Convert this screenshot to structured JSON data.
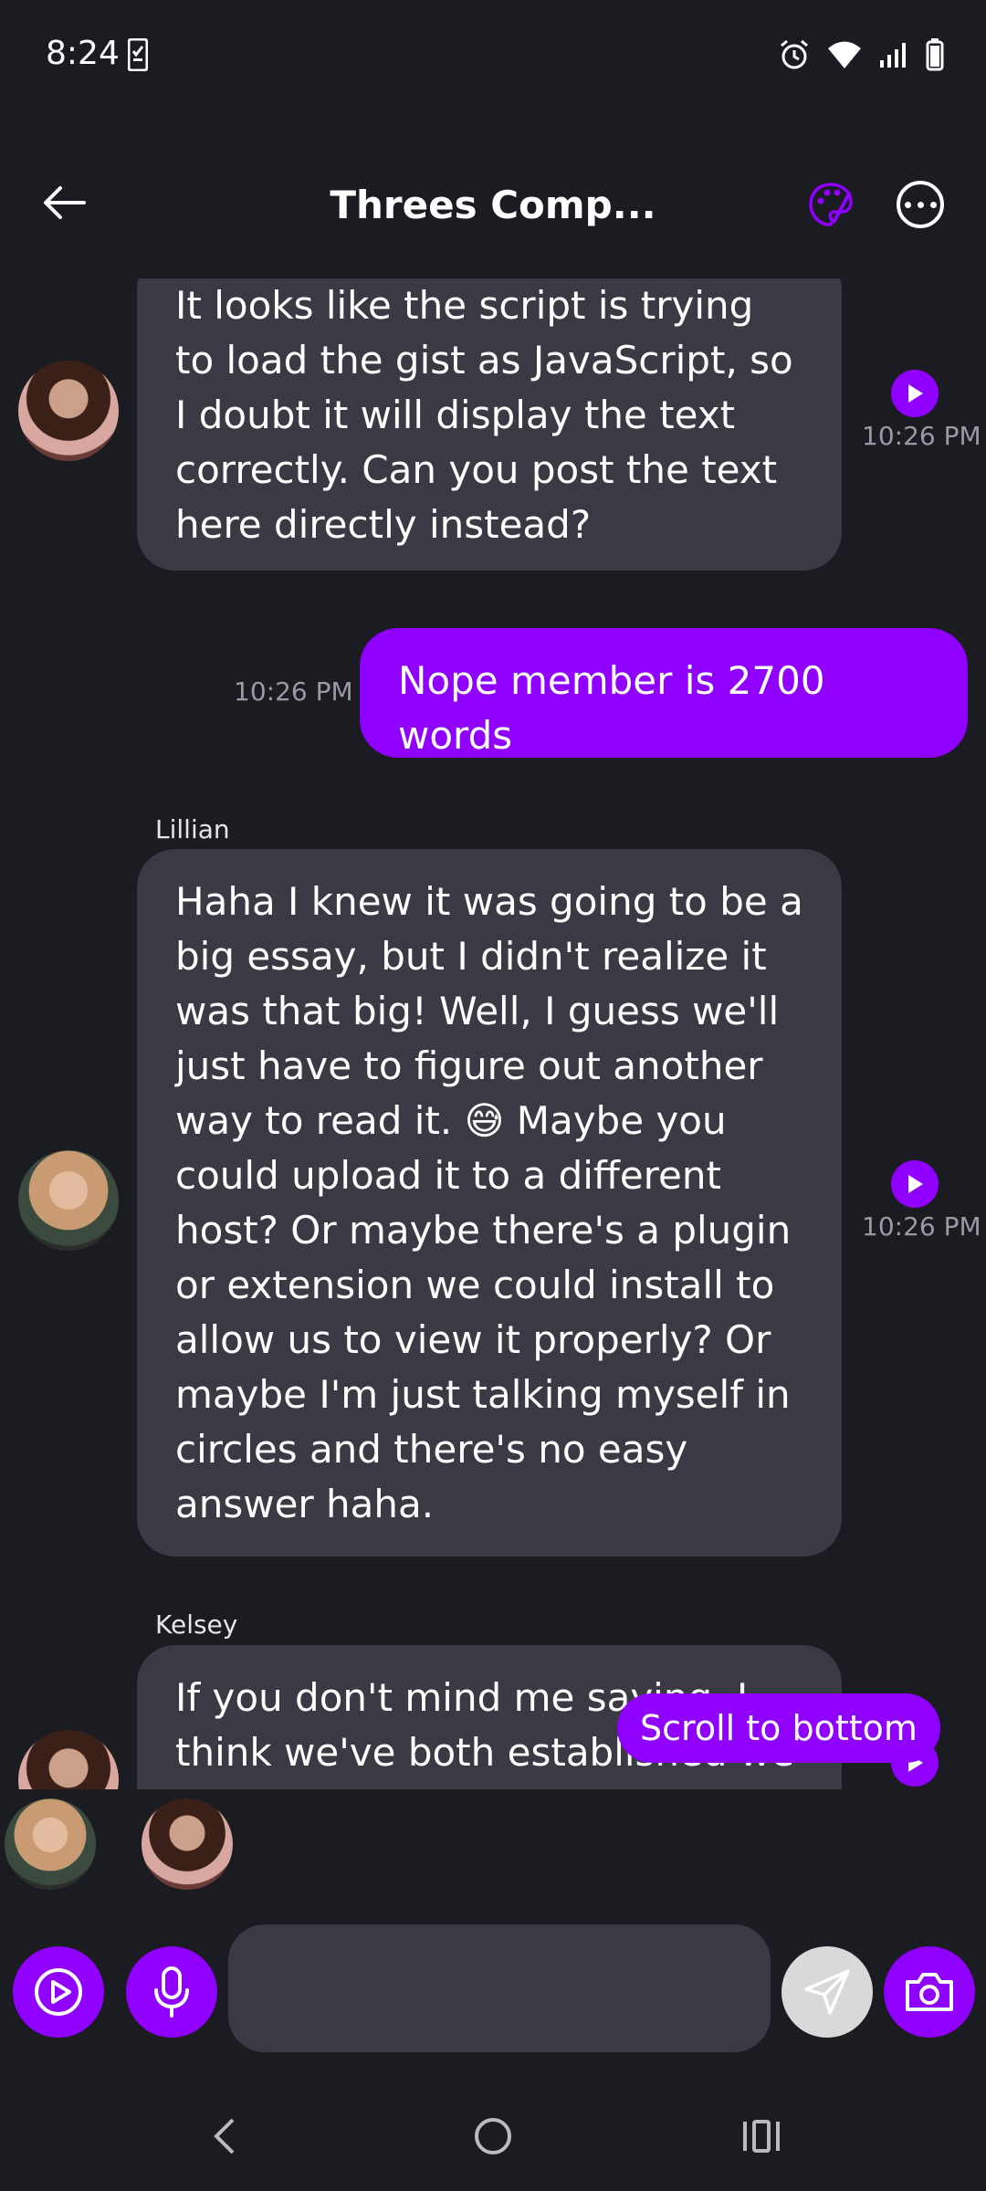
{
  "status_bar": {
    "time": "8:24"
  },
  "header": {
    "title": "Threes Comp..."
  },
  "messages": [
    {
      "type": "received",
      "avatar": "avatar-kelsey",
      "text": "It looks like the script is trying to load the gist as JavaScript, so I doubt it will display the text correctly. Can you post the text here directly instead?",
      "time": "10:26 PM"
    },
    {
      "type": "sent",
      "text": "Nope member is 2700 words",
      "time": "10:26 PM"
    },
    {
      "type": "received",
      "sender": "Lillian",
      "avatar": "avatar-lillian",
      "text": "Haha I knew it was going to be a big essay, but I didn't realize it was that big! Well, I guess we'll just have to figure out another way to read it. 😅 Maybe you could upload it to a different host? Or maybe there's a plugin or extension we could install to allow us to view it properly? Or maybe I'm just talking myself in circles and there's no easy answer haha.",
      "time": "10:26 PM"
    },
    {
      "type": "received",
      "sender": "Kelsey",
      "avatar": "avatar-kelsey",
      "text": "If you don't mind me saying, I think we've both established we ..."
    }
  ],
  "scroll_to_bottom_label": "Scroll to bottom",
  "composer": {
    "input_value": "",
    "input_placeholder": ""
  },
  "colors": {
    "accent": "#8f00ff",
    "background": "#1b1c22",
    "bubble_received": "#393a43"
  }
}
